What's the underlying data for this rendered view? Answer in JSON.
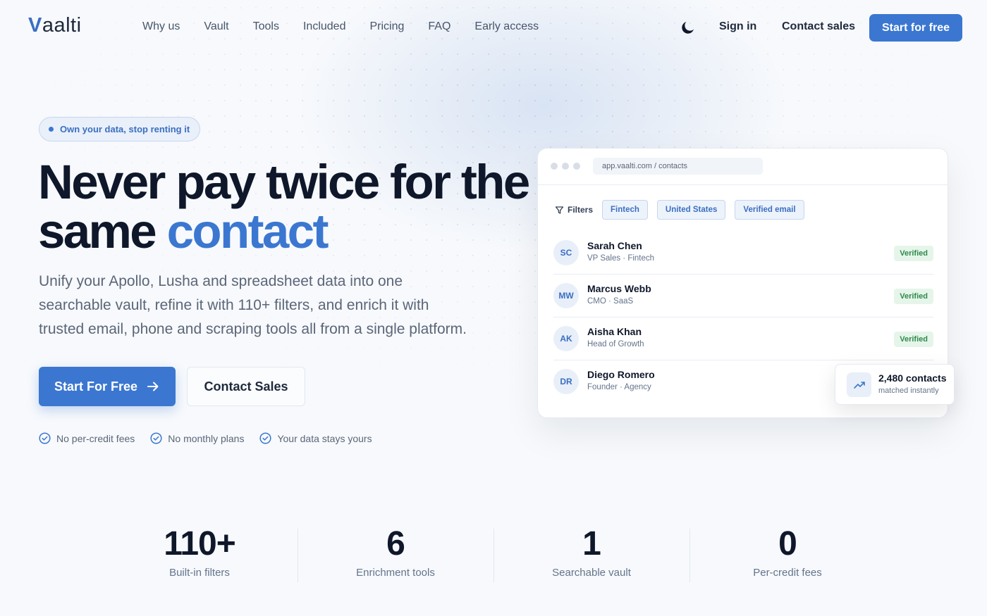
{
  "brand": {
    "logo_text": "Vaalti",
    "logo_v": "V",
    "logo_rest": "aalti",
    "accent_color": "#3b77d0"
  },
  "nav": {
    "links": [
      "Why us",
      "Vault",
      "Tools",
      "Included",
      "Pricing",
      "FAQ",
      "Early access"
    ],
    "theme_toggle_icon": "moon-icon",
    "sign_in": "Sign in",
    "contact_sales": "Contact sales",
    "start_free": "Start for free"
  },
  "hero": {
    "pill": "Own your data, stop renting it",
    "headline_part1": "Never pay twice for the same",
    "headline_accent": "contact",
    "subtitle": "Unify your Apollo, Lusha and spreadsheet data into one searchable vault, refine it with 110+ filters, and enrich it with trusted email, phone and scraping tools all from a single platform.",
    "cta_primary": "Start For Free",
    "cta_secondary": "Contact Sales",
    "perks": [
      "No per-credit fees",
      "No monthly plans",
      "Your data stays yours"
    ]
  },
  "app_preview": {
    "url": "app.vaalti.com / contacts",
    "filters_label": "Filters",
    "chips": [
      "Fintech",
      "United States",
      "Verified email"
    ],
    "contacts": [
      {
        "initials": "SC",
        "name": "Sarah Chen",
        "role": "VP Sales · Fintech",
        "status": "Verified"
      },
      {
        "initials": "MW",
        "name": "Marcus Webb",
        "role": "CMO · SaaS",
        "status": "Verified"
      },
      {
        "initials": "AK",
        "name": "Aisha Khan",
        "role": "Head of Growth",
        "status": "Verified"
      },
      {
        "initials": "DR",
        "name": "Diego Romero",
        "role": "Founder · Agency",
        "status": ""
      }
    ],
    "match_card": {
      "title": "2,480 contacts",
      "subtitle": "matched instantly"
    }
  },
  "stats": [
    {
      "value": "110+",
      "label": "Built-in filters"
    },
    {
      "value": "6",
      "label": "Enrichment tools"
    },
    {
      "value": "1",
      "label": "Searchable vault"
    },
    {
      "value": "0",
      "label": "Per-credit fees"
    }
  ]
}
